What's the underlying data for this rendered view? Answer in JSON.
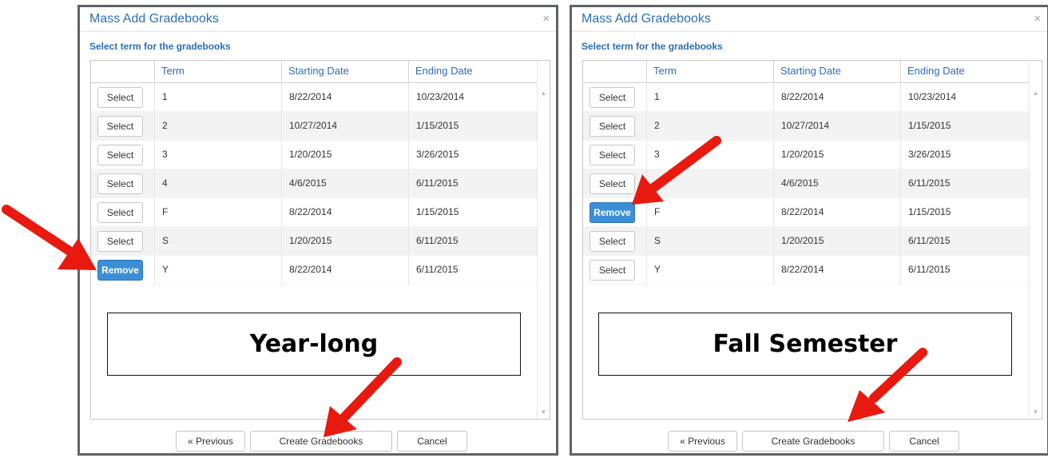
{
  "dialogs": [
    {
      "title": "Mass Add Gradebooks",
      "close_glyph": "×",
      "subtitle": "Select term for the gradebooks",
      "columns": [
        "Term",
        "Starting Date",
        "Ending Date"
      ],
      "rows": [
        {
          "button": "Select",
          "term": "1",
          "start": "8/22/2014",
          "end": "10/23/2014"
        },
        {
          "button": "Select",
          "term": "2",
          "start": "10/27/2014",
          "end": "1/15/2015"
        },
        {
          "button": "Select",
          "term": "3",
          "start": "1/20/2015",
          "end": "3/26/2015"
        },
        {
          "button": "Select",
          "term": "4",
          "start": "4/6/2015",
          "end": "6/11/2015"
        },
        {
          "button": "Select",
          "term": "F",
          "start": "8/22/2014",
          "end": "1/15/2015"
        },
        {
          "button": "Select",
          "term": "S",
          "start": "1/20/2015",
          "end": "6/11/2015"
        },
        {
          "button": "Remove",
          "term": "Y",
          "start": "8/22/2014",
          "end": "6/11/2015"
        }
      ],
      "footer": {
        "previous": "« Previous",
        "create": "Create Gradebooks",
        "cancel": "Cancel"
      }
    },
    {
      "title": "Mass Add Gradebooks",
      "close_glyph": "×",
      "subtitle": "Select term for the gradebooks",
      "columns": [
        "Term",
        "Starting Date",
        "Ending Date"
      ],
      "rows": [
        {
          "button": "Select",
          "term": "1",
          "start": "8/22/2014",
          "end": "10/23/2014"
        },
        {
          "button": "Select",
          "term": "2",
          "start": "10/27/2014",
          "end": "1/15/2015"
        },
        {
          "button": "Select",
          "term": "3",
          "start": "1/20/2015",
          "end": "3/26/2015"
        },
        {
          "button": "Select",
          "term": "4",
          "start": "4/6/2015",
          "end": "6/11/2015"
        },
        {
          "button": "Remove",
          "term": "F",
          "start": "8/22/2014",
          "end": "1/15/2015"
        },
        {
          "button": "Select",
          "term": "S",
          "start": "1/20/2015",
          "end": "6/11/2015"
        },
        {
          "button": "Select",
          "term": "Y",
          "start": "8/22/2014",
          "end": "6/11/2015"
        }
      ],
      "footer": {
        "previous": "« Previous",
        "create": "Create Gradebooks",
        "cancel": "Cancel"
      }
    }
  ],
  "annotations": {
    "left_label": "Year-long",
    "right_label": "Fall Semester",
    "arrow_color": "#e8190f"
  },
  "colors": {
    "title_blue": "#2a6ebb",
    "remove_button": "#3c8fd6",
    "dialog_border": "#5f6368",
    "stripe": "#f3f3f3"
  },
  "icons": {
    "close": "close-icon",
    "scroll_up": "scroll-up-icon",
    "scroll_down": "scroll-down-icon"
  }
}
